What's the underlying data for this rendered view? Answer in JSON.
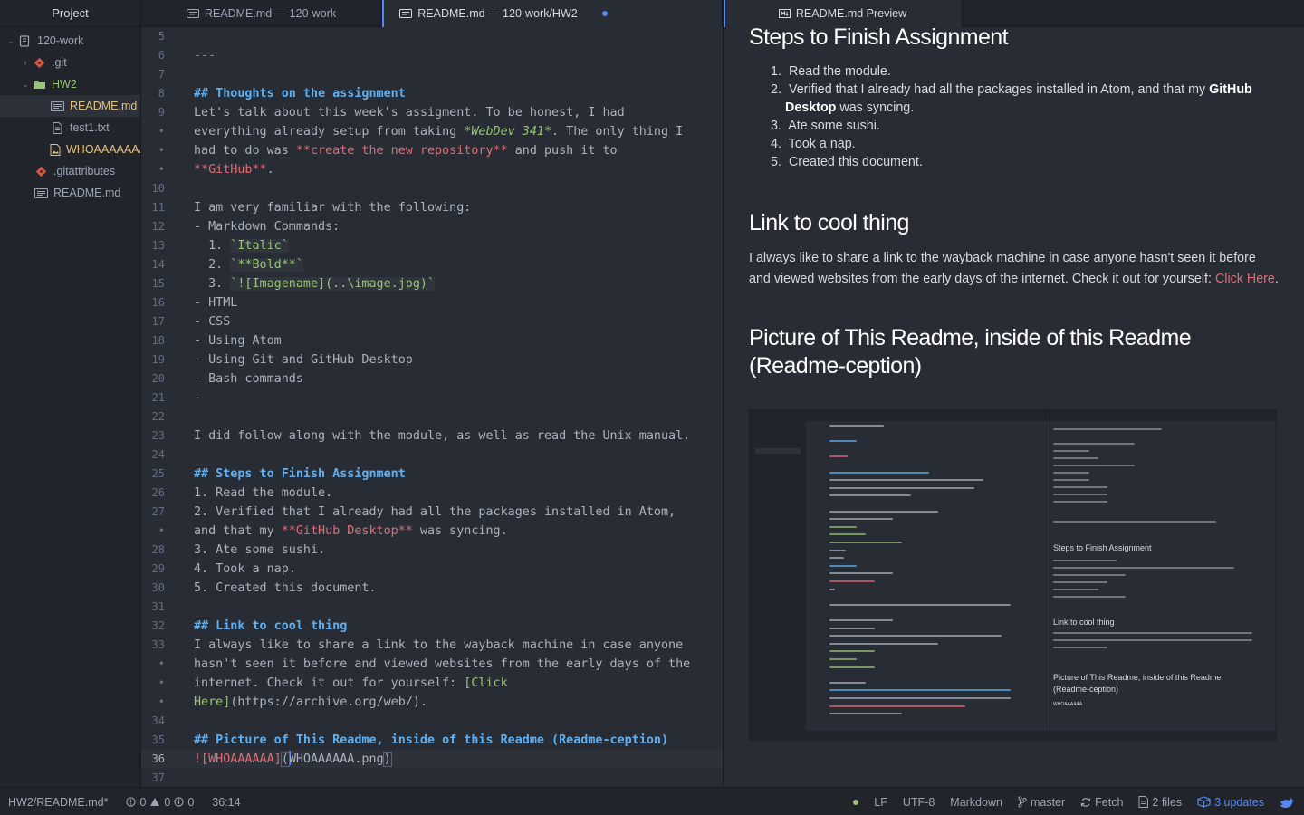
{
  "tree": {
    "header": "Project",
    "items": [
      {
        "label": "120-work",
        "type": "root-folder"
      },
      {
        "label": ".git",
        "type": "folder"
      },
      {
        "label": "HW2",
        "type": "folder-open"
      },
      {
        "label": "README.md",
        "type": "file",
        "selected": true
      },
      {
        "label": "test1.txt",
        "type": "file"
      },
      {
        "label": "WHOAAAAAAA.png",
        "type": "image"
      },
      {
        "label": ".gitattributes",
        "type": "git-file"
      },
      {
        "label": "README.md",
        "type": "file"
      }
    ]
  },
  "tabs": {
    "left": [
      {
        "label": "README.md — 120-work",
        "active": false
      },
      {
        "label": "README.md — 120-work/HW2",
        "active": true,
        "modified": true
      }
    ],
    "right": [
      {
        "label": "README.md Preview",
        "active": true
      }
    ]
  },
  "editor": {
    "gutter": [
      "5",
      "6",
      "7",
      "8",
      "9",
      "•",
      "•",
      "•",
      "10",
      "11",
      "12",
      "13",
      "14",
      "15",
      "16",
      "17",
      "18",
      "19",
      "20",
      "21",
      "22",
      "23",
      "24",
      "25",
      "26",
      "27",
      "•",
      "28",
      "29",
      "30",
      "31",
      "32",
      "33",
      "•",
      "•",
      "•",
      "34",
      "35",
      "36",
      "37"
    ],
    "lines": {
      "l6": "---",
      "l8": "## Thoughts on the assignment",
      "l9": "Let's talk about this week's assigment. To be honest, I had",
      "l9b_a": "everything already setup from taking ",
      "l9b_em": "*WebDev 341*",
      "l9b_b": ". The only thing I",
      "l9c_a": "had to do was ",
      "l9c_bold": "**create the new repository**",
      "l9c_b": " and push it to",
      "l9d_bold": "**GitHub**",
      "l9d_b": ".",
      "l11": "I am very familiar with the following:",
      "l12": "- Markdown Commands:",
      "l13_a": "  1. ",
      "l13_code": "`Italic`",
      "l14_a": "  2. ",
      "l14_code": "`**Bold**`",
      "l15_a": "  3. ",
      "l15_code": "`![Imagename](..\\image.jpg)`",
      "l16": "- HTML",
      "l17": "- CSS",
      "l18": "- Using Atom",
      "l19": "- Using Git and GitHub Desktop",
      "l20": "- Bash commands",
      "l21": "-",
      "l23": "I did follow along with the module, as well as read the Unix manual.",
      "l25": "## Steps to Finish Assignment",
      "l26": "1. Read the module.",
      "l27": "2. Verified that I already had all the packages installed in Atom,",
      "l27b_a": "and that my ",
      "l27b_bold": "**GitHub Desktop**",
      "l27b_b": " was syncing.",
      "l28": "3. Ate some sushi.",
      "l29": "4. Took a nap.",
      "l30": "5. Created this document.",
      "l32": "## Link to cool thing",
      "l33": "I always like to share a link to the wayback machine in case anyone",
      "l33b": "hasn't seen it before and viewed websites from the early days of the",
      "l33c_a": "internet. Check it out for yourself: ",
      "l33c_link": "[Click",
      "l33d_link": "Here]",
      "l33d_url": "(https://archive.org/web/).",
      "l35": "## Picture of This Readme, inside of this Readme (Readme-ception)",
      "l36_img": "![WHOAAAAAA]",
      "l36_b1": "(",
      "l36_c": "WHOAAAAAA.png",
      "l36_b2": ")"
    }
  },
  "preview": {
    "h_steps": "Steps to Finish Assignment",
    "steps": [
      {
        "num": "1.",
        "text": "Read the module."
      },
      {
        "num": "2.",
        "text": "Verified that I already had all the packages installed in Atom, and that my",
        "strong": "GitHub Desktop",
        "after": " was syncing."
      },
      {
        "num": "3.",
        "text": "Ate some sushi."
      },
      {
        "num": "4.",
        "text": "Took a nap."
      },
      {
        "num": "5.",
        "text": "Created this document."
      }
    ],
    "h_link": "Link to cool thing",
    "link_p1": "I always like to share a link to the wayback machine in case anyone hasn't seen it before and viewed websites from the early days of the internet. Check it out for yourself: ",
    "link_text": "Click Here",
    "link_p2": ".",
    "h_pic_1": "Picture of This Readme, inside of this Readme",
    "h_pic_2": "(Readme-ception)"
  },
  "mini": {
    "steps_title": "Steps to Finish Assignment",
    "link_title": "Link to cool thing",
    "pic_title_1": "Picture of This Readme, inside of this Readme",
    "pic_title_2": "(Readme-ception)",
    "whoa": "WHOAAAAAA"
  },
  "status": {
    "file": "HW2/README.md*",
    "errors": "0",
    "warnings": "0",
    "infos": "0",
    "cursor": "36:14",
    "line_ending": "LF",
    "encoding": "UTF-8",
    "grammar": "Markdown",
    "branch": "master",
    "fetch": "Fetch",
    "files": "2 files",
    "updates": "3 updates"
  },
  "colors": {
    "accent": "#568af2",
    "heading": "#61afef",
    "string": "#98c379",
    "keyword": "#e06c75",
    "modified": "#e5c07b"
  }
}
